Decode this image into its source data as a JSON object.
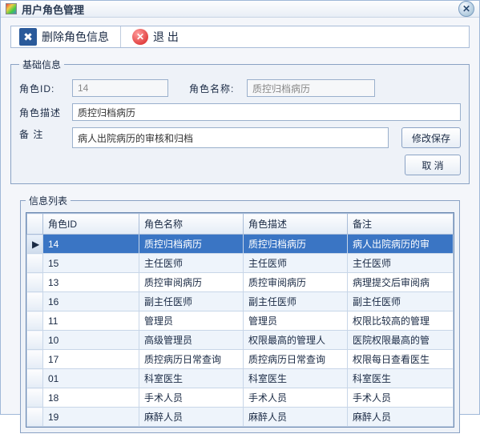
{
  "window": {
    "title": "用户角色管理"
  },
  "toolbar": {
    "delete_label": "删除角色信息",
    "exit_label": "退 出"
  },
  "basic_info": {
    "legend": "基础信息",
    "role_id_label": "角色ID:",
    "role_id_value": "14",
    "role_name_label": "角色名称:",
    "role_name_value": "质控归档病历",
    "role_desc_label": "角色描述",
    "role_desc_value": "质控归档病历",
    "remark_label": "备  注",
    "remark_value": "病人出院病历的审核和归档",
    "save_label": "修改保存",
    "cancel_label": "取  消"
  },
  "list": {
    "legend": "信息列表",
    "columns": [
      "角色ID",
      "角色名称",
      "角色描述",
      "备注"
    ],
    "rows": [
      {
        "id": "14",
        "name": "质控归档病历",
        "desc": "质控归档病历",
        "note": "病人出院病历的审",
        "selected": true
      },
      {
        "id": "15",
        "name": "主任医师",
        "desc": "主任医师",
        "note": "主任医师"
      },
      {
        "id": "13",
        "name": "质控审阅病历",
        "desc": "质控审阅病历",
        "note": "病理提交后审阅病"
      },
      {
        "id": "16",
        "name": "副主任医师",
        "desc": "副主任医师",
        "note": "副主任医师"
      },
      {
        "id": "11",
        "name": "管理员",
        "desc": "管理员",
        "note": "权限比较高的管理"
      },
      {
        "id": "10",
        "name": "高级管理员",
        "desc": "权限最高的管理人",
        "note": "医院权限最高的管"
      },
      {
        "id": "17",
        "name": "质控病历日常查询",
        "desc": "质控病历日常查询",
        "note": "权限每日查看医生"
      },
      {
        "id": "01",
        "name": "科室医生",
        "desc": "科室医生",
        "note": "科室医生"
      },
      {
        "id": "18",
        "name": "手术人员",
        "desc": "手术人员",
        "note": "手术人员"
      },
      {
        "id": "19",
        "name": "麻醉人员",
        "desc": "麻醉人员",
        "note": "麻醉人员"
      }
    ]
  }
}
